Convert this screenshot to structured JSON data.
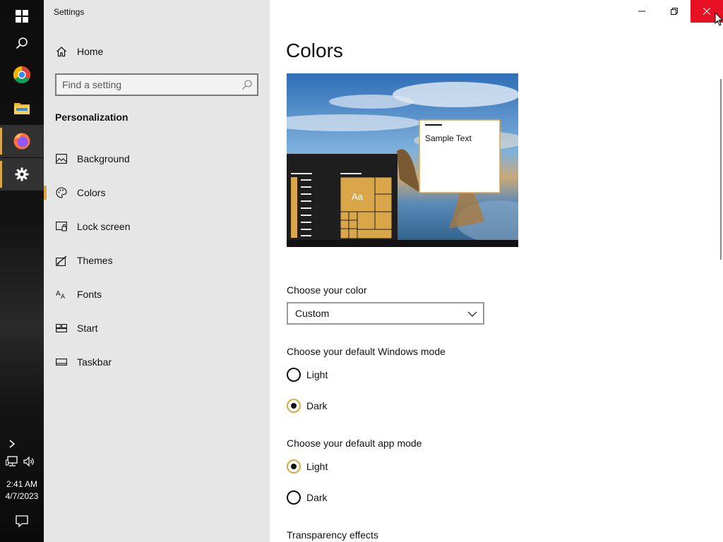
{
  "window": {
    "title": "Settings"
  },
  "taskbar": {
    "time": "2:41 AM",
    "date": "4/7/2023",
    "icons": [
      "windows-start-icon",
      "search-icon",
      "chrome-icon",
      "file-explorer-icon",
      "firefox-icon",
      "settings-gear-icon",
      "show-hidden-icons-chevron",
      "network-icon",
      "volume-icon",
      "action-center-icon"
    ]
  },
  "nav": {
    "home_label": "Home",
    "search_placeholder": "Find a setting",
    "section_title": "Personalization",
    "items": [
      {
        "label": "Background",
        "icon": "picture-icon"
      },
      {
        "label": "Colors",
        "icon": "palette-icon",
        "selected": true
      },
      {
        "label": "Lock screen",
        "icon": "lock-screen-icon"
      },
      {
        "label": "Themes",
        "icon": "themes-icon"
      },
      {
        "label": "Fonts",
        "icon": "fonts-icon"
      },
      {
        "label": "Start",
        "icon": "start-icon"
      },
      {
        "label": "Taskbar",
        "icon": "taskbar-icon"
      }
    ]
  },
  "main": {
    "title": "Colors",
    "preview": {
      "sample_text": "Sample Text",
      "tile_text": "Aa"
    },
    "choose_color": {
      "label": "Choose your color",
      "value": "Custom"
    },
    "windows_mode": {
      "label": "Choose your default Windows mode",
      "options": [
        {
          "label": "Light",
          "checked": false
        },
        {
          "label": "Dark",
          "checked": true
        }
      ]
    },
    "app_mode": {
      "label": "Choose your default app mode",
      "options": [
        {
          "label": "Light",
          "checked": true
        },
        {
          "label": "Dark",
          "checked": false
        }
      ]
    },
    "transparency_label": "Transparency effects"
  },
  "colors": {
    "accent": "#d9a64a",
    "close_red": "#e81123",
    "nav_bg": "#e6e6e6"
  }
}
